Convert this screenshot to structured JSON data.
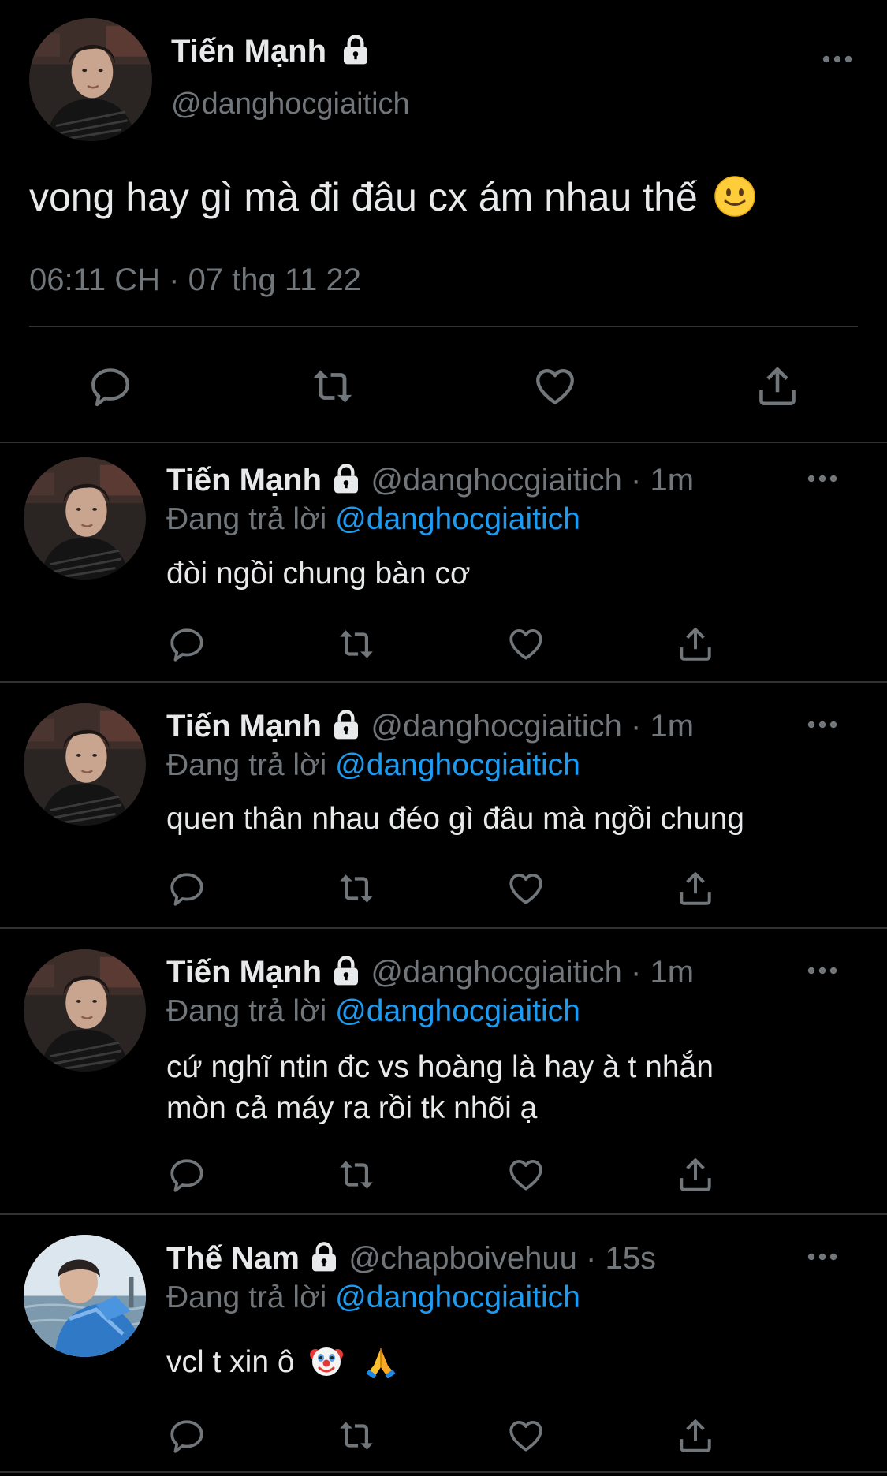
{
  "colors": {
    "background": "#000000",
    "text": "#e7e9ea",
    "muted": "#71767b",
    "accent": "#1d9bf0",
    "divider": "#2f3336"
  },
  "main_tweet": {
    "author_name": "Tiến Mạnh",
    "author_handle": "@danghocgiaitich",
    "protected_icon": "lock-icon",
    "text": "vong hay gì mà đi đâu cx ám nhau thế",
    "emoji": "slightly-smiling-face",
    "timestamp": "06:11 CH · 07 thg 11 22",
    "actions": [
      "reply-icon",
      "retweet-icon",
      "like-icon",
      "share-icon"
    ]
  },
  "replies": [
    {
      "author_name": "Tiến Mạnh",
      "author_handle": "@danghocgiaitich",
      "separator": "·",
      "time": "1m",
      "replying_prefix": "Đang trả lời",
      "replying_to": "@danghocgiaitich",
      "text": "đòi ngồi chung bàn cơ"
    },
    {
      "author_name": "Tiến Mạnh",
      "author_handle": "@danghocgiaitich",
      "separator": "·",
      "time": "1m",
      "replying_prefix": "Đang trả lời",
      "replying_to": "@danghocgiaitich",
      "text": "quen thân nhau đéo gì đâu mà ngồi chung"
    },
    {
      "author_name": "Tiến Mạnh",
      "author_handle": "@danghocgiaitich",
      "separator": "·",
      "time": "1m",
      "replying_prefix": "Đang trả lời",
      "replying_to": "@danghocgiaitich",
      "text_line1": "cứ nghĩ ntin đc vs hoàng là hay à t nhắn",
      "text_line2": "mòn cả máy ra rồi tk nhõi ạ"
    },
    {
      "author_name": "Thế Nam",
      "author_handle": "@chapboivehuu",
      "separator": "·",
      "time": "15s",
      "replying_prefix": "Đang trả lời",
      "replying_to": "@danghocgiaitich",
      "text": "vcl t xin ô",
      "emojis": [
        "clown-face",
        "folded-hands"
      ]
    }
  ]
}
